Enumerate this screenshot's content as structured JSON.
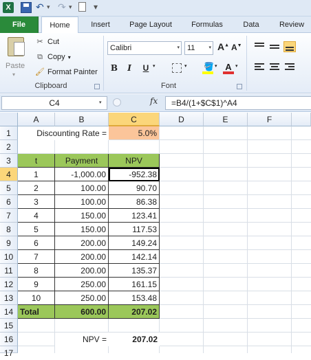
{
  "quick_access": {
    "excel_icon_letter": "X",
    "undo_glyph": "↶",
    "redo_glyph": "↷"
  },
  "tabs": [
    {
      "label": "File"
    },
    {
      "label": "Home"
    },
    {
      "label": "Insert"
    },
    {
      "label": "Page Layout"
    },
    {
      "label": "Formulas"
    },
    {
      "label": "Data"
    },
    {
      "label": "Review"
    }
  ],
  "ribbon": {
    "clipboard": {
      "paste": "Paste",
      "cut": "Cut",
      "copy": "Copy",
      "format_painter": "Format Painter",
      "group_label": "Clipboard"
    },
    "font": {
      "font_name": "Calibri",
      "font_size": "11",
      "bold": "B",
      "italic": "I",
      "underline": "U",
      "grow": "A",
      "shrink": "A",
      "font_color_letter": "A",
      "group_label": "Font",
      "fill_color": "#ffff00",
      "font_color": "#e03030"
    }
  },
  "formula_bar": {
    "name_box": "C4",
    "fx": "fx",
    "formula": "=B4/(1+$C$1)^A4"
  },
  "columns": [
    "A",
    "B",
    "C",
    "D",
    "E",
    "F"
  ],
  "rows": [
    "1",
    "2",
    "3",
    "4",
    "5",
    "6",
    "7",
    "8",
    "9",
    "10",
    "11",
    "12",
    "13",
    "14",
    "15",
    "16",
    "17"
  ],
  "sheet": {
    "rate_label": "Discounting Rate =",
    "rate_value": "5.0%",
    "headers": {
      "t": "t",
      "payment": "Payment",
      "npv": "NPV"
    },
    "data": [
      {
        "t": "1",
        "payment": "-1,000.00",
        "npv": "-952.38"
      },
      {
        "t": "2",
        "payment": "100.00",
        "npv": "90.70"
      },
      {
        "t": "3",
        "payment": "100.00",
        "npv": "86.38"
      },
      {
        "t": "4",
        "payment": "150.00",
        "npv": "123.41"
      },
      {
        "t": "5",
        "payment": "150.00",
        "npv": "117.53"
      },
      {
        "t": "6",
        "payment": "200.00",
        "npv": "149.24"
      },
      {
        "t": "7",
        "payment": "200.00",
        "npv": "142.14"
      },
      {
        "t": "8",
        "payment": "200.00",
        "npv": "135.37"
      },
      {
        "t": "9",
        "payment": "250.00",
        "npv": "161.15"
      },
      {
        "t": "10",
        "payment": "250.00",
        "npv": "153.48"
      }
    ],
    "total": {
      "label": "Total",
      "payment": "600.00",
      "npv": "207.02"
    },
    "npv_label": "NPV =",
    "npv_value": "207.02"
  },
  "colors": {
    "green": "#9bc75a",
    "peach": "#fbc59a",
    "selected": "#fbd67a",
    "file_tab": "#2a8a3a"
  }
}
